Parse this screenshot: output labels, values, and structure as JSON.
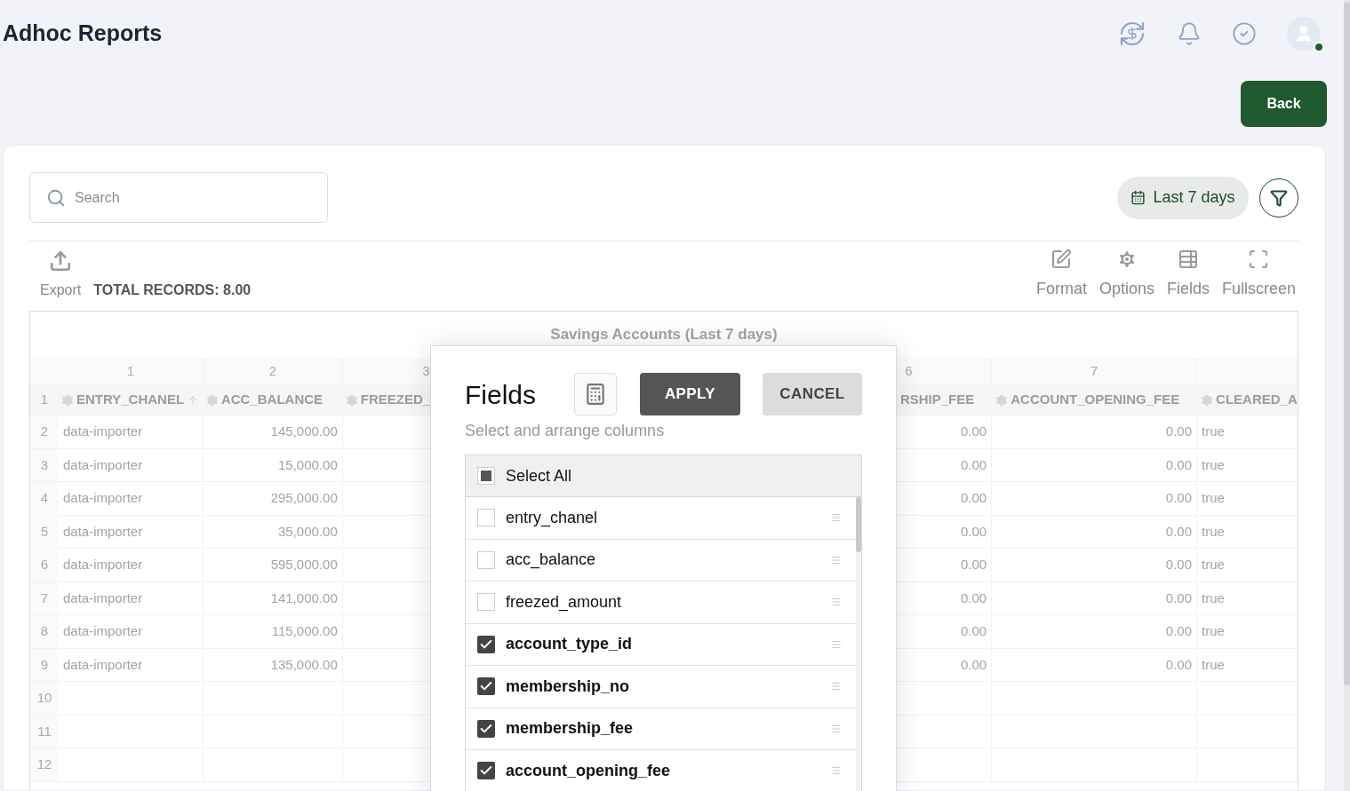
{
  "header": {
    "title": "Adhoc Reports",
    "avatar_online": true
  },
  "back_button": "Back",
  "search": {
    "placeholder": "Search"
  },
  "date_range": "Last 7 days",
  "toolbar": {
    "export": "Export",
    "total_records": "TOTAL RECORDS: 8.00",
    "actions": [
      {
        "label": "Format",
        "kind": "format"
      },
      {
        "label": "Options",
        "kind": "options"
      },
      {
        "label": "Fields",
        "kind": "fields"
      },
      {
        "label": "Fullscreen",
        "kind": "fullscreen"
      }
    ]
  },
  "table": {
    "title": "Savings Accounts (Last 7 days)",
    "left_columns": [
      {
        "index": "1",
        "heading": "ENTRY_CHANEL",
        "sorted": true
      },
      {
        "index": "2",
        "heading": "ACC_BALANCE",
        "sorted": false
      },
      {
        "index": "3",
        "heading": "FREEZED_",
        "sorted": false
      }
    ],
    "right_columns": [
      {
        "index": "6",
        "heading": "RSHIP_FEE"
      },
      {
        "index": "7",
        "heading": "ACCOUNT_OPENING_FEE"
      },
      {
        "heading": "CLEARED_A"
      }
    ],
    "header_row_number": "1",
    "rows": [
      {
        "number": "2",
        "cells": [
          "data-importer",
          "145,000.00"
        ],
        "right_cells": [
          "0.00",
          "0.00",
          "true"
        ]
      },
      {
        "number": "3",
        "cells": [
          "data-importer",
          "15,000.00"
        ],
        "right_cells": [
          "0.00",
          "0.00",
          "true"
        ]
      },
      {
        "number": "4",
        "cells": [
          "data-importer",
          "295,000.00"
        ],
        "right_cells": [
          "0.00",
          "0.00",
          "true"
        ]
      },
      {
        "number": "5",
        "cells": [
          "data-importer",
          "35,000.00"
        ],
        "right_cells": [
          "0.00",
          "0.00",
          "true"
        ]
      },
      {
        "number": "6",
        "cells": [
          "data-importer",
          "595,000.00"
        ],
        "right_cells": [
          "0.00",
          "0.00",
          "true"
        ]
      },
      {
        "number": "7",
        "cells": [
          "data-importer",
          "141,000.00"
        ],
        "right_cells": [
          "0.00",
          "0.00",
          "true"
        ]
      },
      {
        "number": "8",
        "cells": [
          "data-importer",
          "115,000.00"
        ],
        "right_cells": [
          "0.00",
          "0.00",
          "true"
        ]
      },
      {
        "number": "9",
        "cells": [
          "data-importer",
          "135,000.00"
        ],
        "right_cells": [
          "0.00",
          "0.00",
          "true"
        ]
      },
      {
        "number": "10"
      },
      {
        "number": "11"
      },
      {
        "number": "12"
      }
    ]
  },
  "modal": {
    "title": "Fields",
    "apply": "APPLY",
    "cancel": "CANCEL",
    "subtitle": "Select and arrange columns",
    "select_all": {
      "label": "Select All",
      "indeterminate": true
    },
    "fields": [
      {
        "name": "entry_chanel",
        "checked": false
      },
      {
        "name": "acc_balance",
        "checked": false
      },
      {
        "name": "freezed_amount",
        "checked": false
      },
      {
        "name": "account_type_id",
        "checked": true
      },
      {
        "name": "membership_no",
        "checked": true
      },
      {
        "name": "membership_fee",
        "checked": true
      },
      {
        "name": "account_opening_fee",
        "checked": true
      }
    ]
  }
}
